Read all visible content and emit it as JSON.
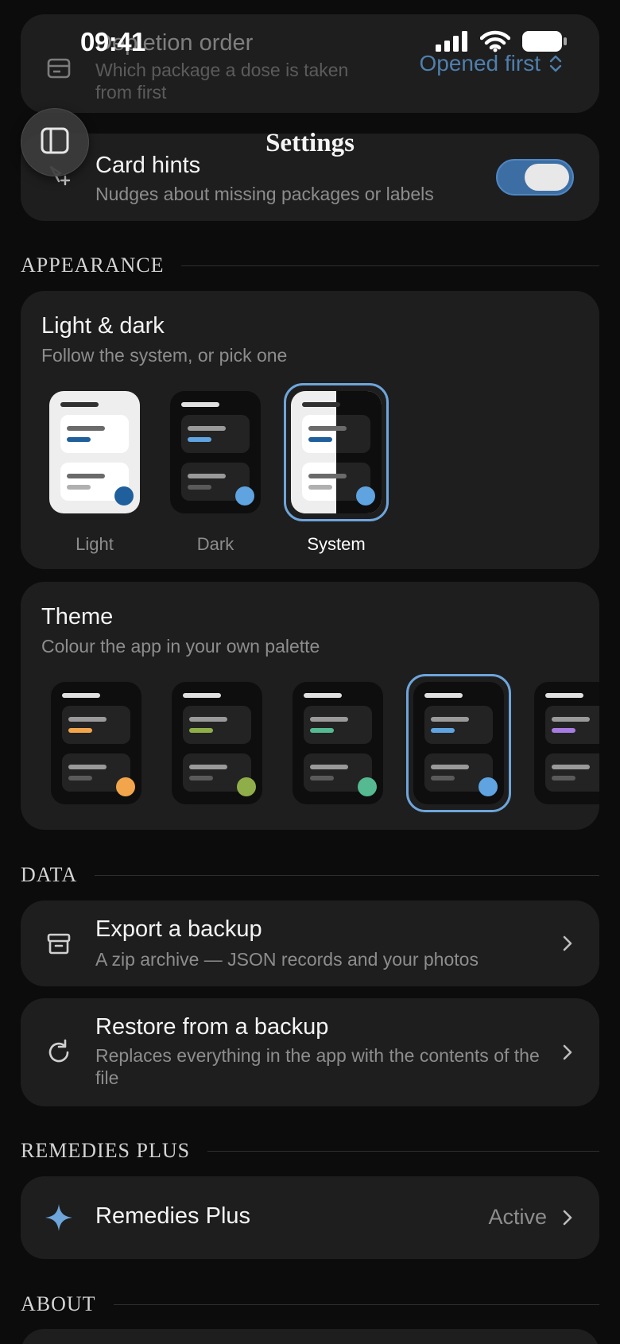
{
  "status_bar": {
    "time": "09:41"
  },
  "nav": {
    "title": "Settings"
  },
  "general": {
    "depletion": {
      "title": "Depletion order",
      "subtitle": "Which package a dose is taken from first",
      "value": "Opened first"
    },
    "card_hints": {
      "title": "Card hints",
      "subtitle": "Nudges about missing packages or labels",
      "enabled": true
    }
  },
  "appearance": {
    "header": "APPEARANCE",
    "mode": {
      "title": "Light & dark",
      "subtitle": "Follow the system, or pick one",
      "options": [
        {
          "label": "Light"
        },
        {
          "label": "Dark"
        },
        {
          "label": "System"
        }
      ],
      "selected": "System"
    },
    "theme": {
      "title": "Theme",
      "subtitle": "Colour the app in your own palette",
      "swatches": [
        "#f2a54a",
        "#8fae4a",
        "#55b991",
        "#5fa3e0",
        "#a77be0"
      ],
      "selected_index": 3
    }
  },
  "data_section": {
    "header": "DATA",
    "export": {
      "title": "Export a backup",
      "subtitle": "A zip archive — JSON records and your photos"
    },
    "restore": {
      "title": "Restore from a backup",
      "subtitle": "Replaces everything in the app with the contents of the file"
    }
  },
  "plus_section": {
    "header": "REMEDIES PLUS",
    "item": {
      "title": "Remedies Plus",
      "status": "Active"
    }
  },
  "about_section": {
    "header": "ABOUT"
  },
  "colors": {
    "accent": "#6ea5db",
    "toggle_on": "#3d6ea3",
    "background": "#0c0c0c",
    "card": "#1e1e1e"
  }
}
